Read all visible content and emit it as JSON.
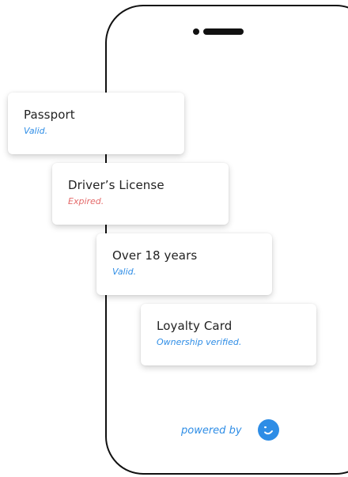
{
  "cards": [
    {
      "title": "Passport",
      "status": "Valid.",
      "state": "valid"
    },
    {
      "title": "Driver’s License",
      "status": "Expired.",
      "state": "expired"
    },
    {
      "title": "Over 18 years",
      "status": "Valid.",
      "state": "valid"
    },
    {
      "title": "Loyalty Card",
      "status": "Ownership verified.",
      "state": "valid"
    }
  ],
  "footer": {
    "powered_by": "powered by",
    "logo_icon": "smile-logo-icon"
  },
  "colors": {
    "valid": "#2e8de6",
    "expired": "#e46a6a",
    "brand": "#2e8de6",
    "outline": "#111111"
  }
}
